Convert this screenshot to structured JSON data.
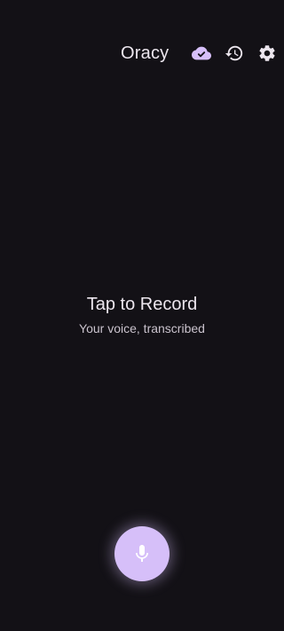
{
  "app_bar": {
    "title": "Oracy",
    "icons": {
      "cloud": "cloud-done-icon",
      "history": "history-icon",
      "settings": "settings-gear-icon"
    }
  },
  "empty_state": {
    "title": "Tap to Record",
    "subtitle": "Your voice, transcribed"
  },
  "record_button": {
    "icon": "microphone-icon"
  },
  "colors": {
    "background": "#131116",
    "accent": "#D6BFF9",
    "text_primary": "#ECE6EE",
    "text_secondary": "#C9C2CC"
  }
}
